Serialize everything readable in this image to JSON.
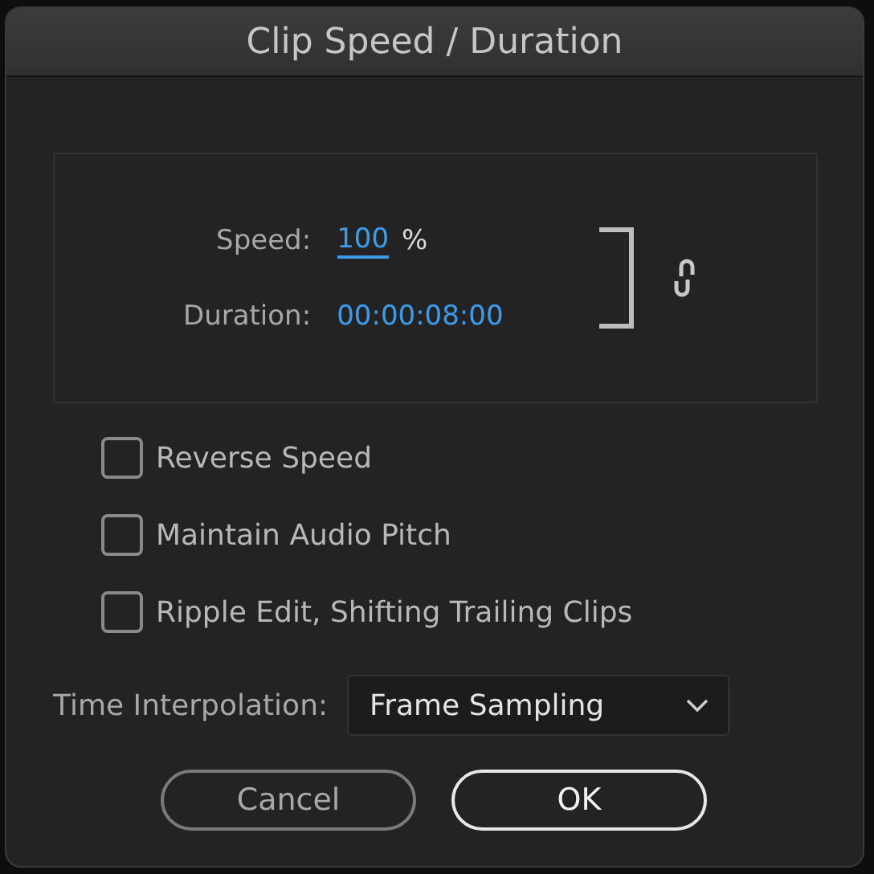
{
  "window": {
    "title": "Clip Speed / Duration"
  },
  "speed": {
    "label": "Speed:",
    "value": "100",
    "unit": "%"
  },
  "duration": {
    "label": "Duration:",
    "value": "00:00:08:00"
  },
  "linked": true,
  "options": [
    {
      "label": "Reverse Speed",
      "checked": false
    },
    {
      "label": "Maintain Audio Pitch",
      "checked": false
    },
    {
      "label": "Ripple Edit, Shifting Trailing Clips",
      "checked": false
    }
  ],
  "time_interpolation": {
    "label": "Time Interpolation:",
    "value": "Frame Sampling"
  },
  "buttons": [
    {
      "label": "Cancel",
      "default": false
    },
    {
      "label": "OK",
      "default": true
    }
  ]
}
